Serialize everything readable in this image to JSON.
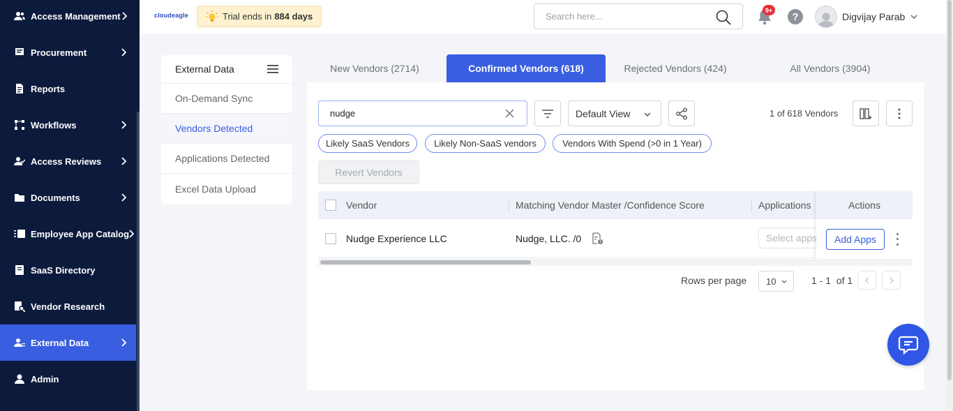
{
  "sidebar": {
    "items": [
      {
        "label": "Access Management",
        "icon": "users-icon",
        "chevron": true
      },
      {
        "label": "Procurement",
        "icon": "cart-icon",
        "chevron": true
      },
      {
        "label": "Reports",
        "icon": "report-icon",
        "chevron": false
      },
      {
        "label": "Workflows",
        "icon": "workflow-icon",
        "chevron": true
      },
      {
        "label": "Access Reviews",
        "icon": "user-check-icon",
        "chevron": true
      },
      {
        "label": "Documents",
        "icon": "folder-icon",
        "chevron": true
      },
      {
        "label": "Employee App Catalog",
        "icon": "catalog-icon",
        "chevron": true
      },
      {
        "label": "SaaS Directory",
        "icon": "directory-icon",
        "chevron": false
      },
      {
        "label": "Vendor Research",
        "icon": "research-icon",
        "chevron": false
      },
      {
        "label": "External Data",
        "icon": "user-data-icon",
        "chevron": true,
        "active": true
      },
      {
        "label": "Admin",
        "icon": "admin-icon",
        "chevron": false
      }
    ]
  },
  "topbar": {
    "logo": "cloudeagle",
    "trial_prefix": "Trial ends in",
    "trial_days": "884 days",
    "search_placeholder": "Search here...",
    "notification_badge": "9+",
    "help": "?",
    "user_name": "Digvijay Parab"
  },
  "subnav": {
    "title": "External Data",
    "items": [
      "On-Demand Sync",
      "Vendors Detected",
      "Applications Detected",
      "Excel Data Upload"
    ],
    "active_index": 1
  },
  "tabs": [
    {
      "label": "New Vendors (2714)",
      "active": false
    },
    {
      "label": "Confirmed Vendors (618)",
      "active": true
    },
    {
      "label": "Rejected Vendors (424)",
      "active": false
    },
    {
      "label": "All Vendors (3904)",
      "active": false
    }
  ],
  "toolbar": {
    "filter_value": "nudge",
    "view": "Default View",
    "count_text": "1 of 618 Vendors"
  },
  "chips": [
    "Likely SaaS Vendors",
    "Likely Non-SaaS vendors",
    "Vendors With Spend (>0 in 1 Year)"
  ],
  "revert_button": "Revert Vendors",
  "table": {
    "columns": [
      "Vendor",
      "Matching Vendor Master /Confidence Score",
      "Applications",
      "Actions"
    ],
    "rows": [
      {
        "vendor": "Nudge Experience LLC",
        "match": "Nudge, LLC. /0",
        "applications_placeholder": "Select apps",
        "action": "Add Apps"
      }
    ]
  },
  "pagination": {
    "rows_per_page_label": "Rows per page",
    "rows_per_page": "10",
    "range": "1 - 1",
    "of": "of 1"
  },
  "colors": {
    "sidebar_bg": "#0c1a3c",
    "accent": "#3a5ee0",
    "trial_bg": "#fdf1cf",
    "badge": "#e8303a"
  }
}
